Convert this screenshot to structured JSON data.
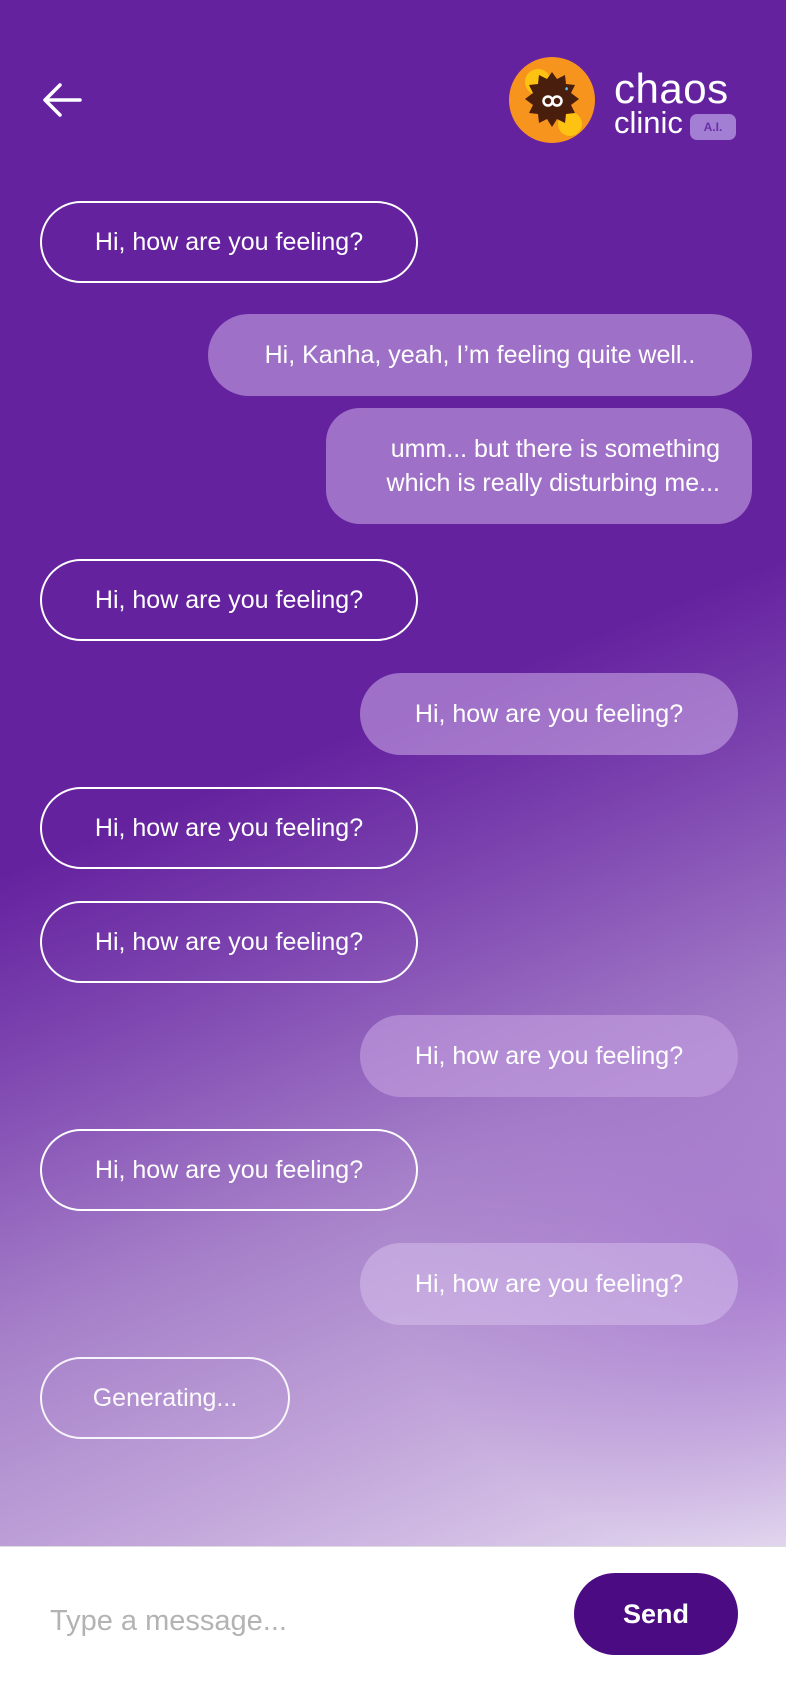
{
  "header": {
    "back_icon": "arrow-left-icon",
    "brand_name": "chaos",
    "brand_sub": "clinic",
    "badge": "A.I.",
    "logo_icon": "chaos-clinic-logo-icon"
  },
  "messages": [
    {
      "sender": "bot",
      "text": "Hi, how are you feeling?"
    },
    {
      "sender": "user",
      "text": "Hi, Kanha, yeah, I’m feeling quite well.."
    },
    {
      "sender": "user",
      "line1": "umm... but there is something",
      "line2": "which is really disturbing me..."
    },
    {
      "sender": "bot",
      "text": "Hi, how are you feeling?"
    },
    {
      "sender": "user",
      "text": "Hi, how are you feeling?"
    },
    {
      "sender": "bot",
      "text": "Hi, how are you feeling?"
    },
    {
      "sender": "bot",
      "text": "Hi, how are you feeling?"
    },
    {
      "sender": "user",
      "text": "Hi, how are you feeling?"
    },
    {
      "sender": "bot",
      "text": "Hi, how are you feeling?"
    },
    {
      "sender": "user",
      "text": "Hi, how are you feeling?"
    },
    {
      "sender": "bot",
      "text": "Generating..."
    }
  ],
  "composer": {
    "placeholder": "Type a message...",
    "send_label": "Send"
  },
  "colors": {
    "background": "#65229f",
    "send_button": "#4b0b82",
    "logo_outer": "#f7941d",
    "logo_inner": "#4a1e0c"
  }
}
